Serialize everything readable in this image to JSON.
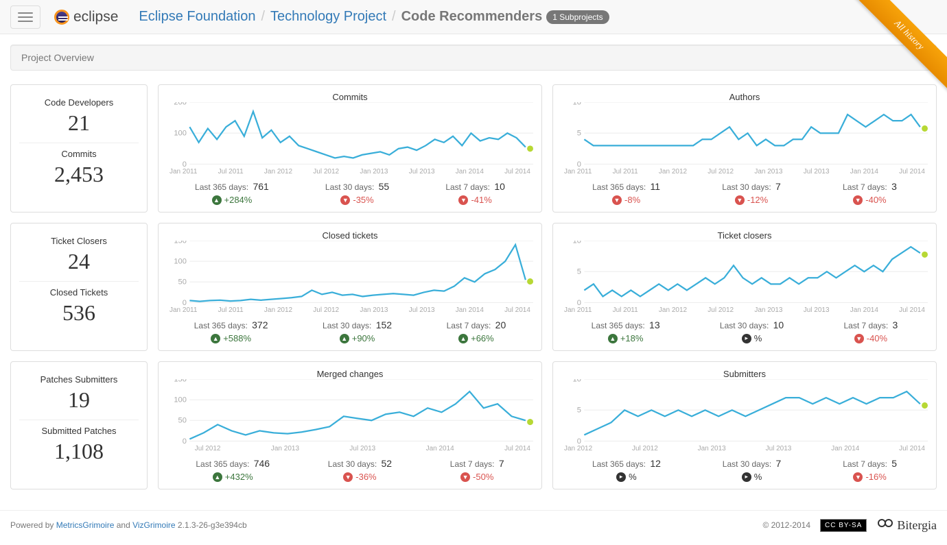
{
  "nav": {
    "logo_text": "eclipse",
    "breadcrumb": [
      {
        "text": "Eclipse Foundation",
        "link": true
      },
      {
        "text": "Technology Project",
        "link": true
      },
      {
        "text": "Code Recommenders",
        "link": false
      }
    ],
    "badge": "1 Subprojects",
    "ribbon": "All history"
  },
  "overview_label": "Project Overview",
  "side_stats": [
    {
      "label1": "Code Developers",
      "value1": "21",
      "label2": "Commits",
      "value2": "2,453"
    },
    {
      "label1": "Ticket Closers",
      "value1": "24",
      "label2": "Closed Tickets",
      "value2": "536"
    },
    {
      "label1": "Patches Submitters",
      "value1": "19",
      "label2": "Submitted Patches",
      "value2": "1,108"
    }
  ],
  "footer": {
    "powered_pre": "Powered by ",
    "link1": "MetricsGrimoire",
    "and": " and ",
    "link2": "VizGrimoire",
    "version": " 2.1.3-26-g3e394cb",
    "copyright": "© 2012-2014",
    "cc": "CC BY-SA",
    "bitergia": "Bitergia"
  },
  "chart_labels": {
    "last365": "Last 365 days: ",
    "last30": "Last 30 days: ",
    "last7": "Last 7 days: "
  },
  "chart_data": [
    {
      "title": "Commits",
      "type": "line",
      "ylim": [
        0,
        200
      ],
      "yticks": [
        0,
        100,
        200
      ],
      "xlabels": [
        "Jan 2011",
        "Jul 2011",
        "Jan 2012",
        "Jul 2012",
        "Jan 2013",
        "Jul 2013",
        "Jan 2014",
        "Jul 2014"
      ],
      "values": [
        120,
        70,
        115,
        80,
        120,
        140,
        90,
        170,
        85,
        110,
        70,
        90,
        60,
        50,
        40,
        30,
        20,
        25,
        20,
        30,
        35,
        40,
        30,
        50,
        55,
        45,
        60,
        80,
        70,
        90,
        60,
        100,
        75,
        85,
        80,
        100,
        85,
        55
      ],
      "last365": {
        "val": "761",
        "dir": "up",
        "pct": "+284%"
      },
      "last30": {
        "val": "55",
        "dir": "down",
        "pct": "-35%"
      },
      "last7": {
        "val": "10",
        "dir": "down",
        "pct": "-41%"
      }
    },
    {
      "title": "Authors",
      "type": "line",
      "ylim": [
        0,
        10
      ],
      "yticks": [
        0.0,
        5.0,
        10.0
      ],
      "xlabels": [
        "Jan 2011",
        "Jul 2011",
        "Jan 2012",
        "Jul 2012",
        "Jan 2013",
        "Jul 2013",
        "Jan 2014",
        "Jul 2014"
      ],
      "values": [
        4,
        3,
        3,
        3,
        3,
        3,
        3,
        3,
        3,
        3,
        3,
        3,
        3,
        4,
        4,
        5,
        6,
        4,
        5,
        3,
        4,
        3,
        3,
        4,
        4,
        6,
        5,
        5,
        5,
        8,
        7,
        6,
        7,
        8,
        7,
        7,
        8,
        6
      ],
      "last365": {
        "val": "11",
        "dir": "down",
        "pct": "-8%"
      },
      "last30": {
        "val": "7",
        "dir": "down",
        "pct": "-12%"
      },
      "last7": {
        "val": "3",
        "dir": "down",
        "pct": "-40%"
      }
    },
    {
      "title": "Closed tickets",
      "type": "line",
      "ylim": [
        0,
        150
      ],
      "yticks": [
        0,
        50,
        100,
        150
      ],
      "xlabels": [
        "Jan 2011",
        "Jul 2011",
        "Jan 2012",
        "Jul 2012",
        "Jan 2013",
        "Jul 2013",
        "Jan 2014",
        "Jul 2014"
      ],
      "values": [
        5,
        3,
        5,
        6,
        4,
        5,
        8,
        6,
        8,
        10,
        12,
        15,
        30,
        20,
        25,
        18,
        20,
        15,
        18,
        20,
        22,
        20,
        18,
        25,
        30,
        28,
        40,
        60,
        50,
        70,
        80,
        100,
        140,
        55
      ],
      "last365": {
        "val": "372",
        "dir": "up",
        "pct": "+588%"
      },
      "last30": {
        "val": "152",
        "dir": "up",
        "pct": "+90%"
      },
      "last7": {
        "val": "20",
        "dir": "up",
        "pct": "+66%"
      }
    },
    {
      "title": "Ticket closers",
      "type": "line",
      "ylim": [
        0,
        10
      ],
      "yticks": [
        0.0,
        5.0,
        10.0
      ],
      "xlabels": [
        "Jan 2011",
        "Jul 2011",
        "Jan 2012",
        "Jul 2012",
        "Jan 2013",
        "Jul 2013",
        "Jan 2014",
        "Jul 2014"
      ],
      "values": [
        2,
        3,
        1,
        2,
        1,
        2,
        1,
        2,
        3,
        2,
        3,
        2,
        3,
        4,
        3,
        4,
        6,
        4,
        3,
        4,
        3,
        3,
        4,
        3,
        4,
        4,
        5,
        4,
        5,
        6,
        5,
        6,
        5,
        7,
        8,
        9,
        8
      ],
      "last365": {
        "val": "13",
        "dir": "up",
        "pct": "+18%"
      },
      "last30": {
        "val": "10",
        "dir": "neutral",
        "pct": "%"
      },
      "last7": {
        "val": "3",
        "dir": "down",
        "pct": "-40%"
      }
    },
    {
      "title": "Merged changes",
      "type": "line",
      "ylim": [
        0,
        150
      ],
      "yticks": [
        0,
        50,
        100,
        150
      ],
      "xlabels": [
        "",
        "Jul 2012",
        "",
        "Jan 2013",
        "",
        "Jul 2013",
        "",
        "Jan 2014",
        "",
        "Jul 2014"
      ],
      "values": [
        5,
        20,
        40,
        25,
        15,
        25,
        20,
        18,
        22,
        28,
        35,
        60,
        55,
        50,
        65,
        70,
        60,
        80,
        70,
        90,
        120,
        80,
        90,
        60,
        50
      ],
      "last365": {
        "val": "746",
        "dir": "up",
        "pct": "+432%"
      },
      "last30": {
        "val": "52",
        "dir": "down",
        "pct": "-36%"
      },
      "last7": {
        "val": "7",
        "dir": "down",
        "pct": "-50%"
      }
    },
    {
      "title": "Submitters",
      "type": "line",
      "ylim": [
        0,
        10
      ],
      "yticks": [
        0.0,
        5.0,
        10.0
      ],
      "xlabels": [
        "Jan 2012",
        "",
        "Jul 2012",
        "",
        "Jan 2013",
        "",
        "Jul 2013",
        "",
        "Jan 2014",
        "",
        "Jul 2014"
      ],
      "values": [
        1,
        2,
        3,
        5,
        4,
        5,
        4,
        5,
        4,
        5,
        4,
        5,
        4,
        5,
        6,
        7,
        7,
        6,
        7,
        6,
        7,
        6,
        7,
        7,
        8,
        6
      ],
      "last365": {
        "val": "12",
        "dir": "neutral",
        "pct": "%"
      },
      "last30": {
        "val": "7",
        "dir": "neutral",
        "pct": "%"
      },
      "last7": {
        "val": "5",
        "dir": "down",
        "pct": "-16%"
      }
    }
  ]
}
